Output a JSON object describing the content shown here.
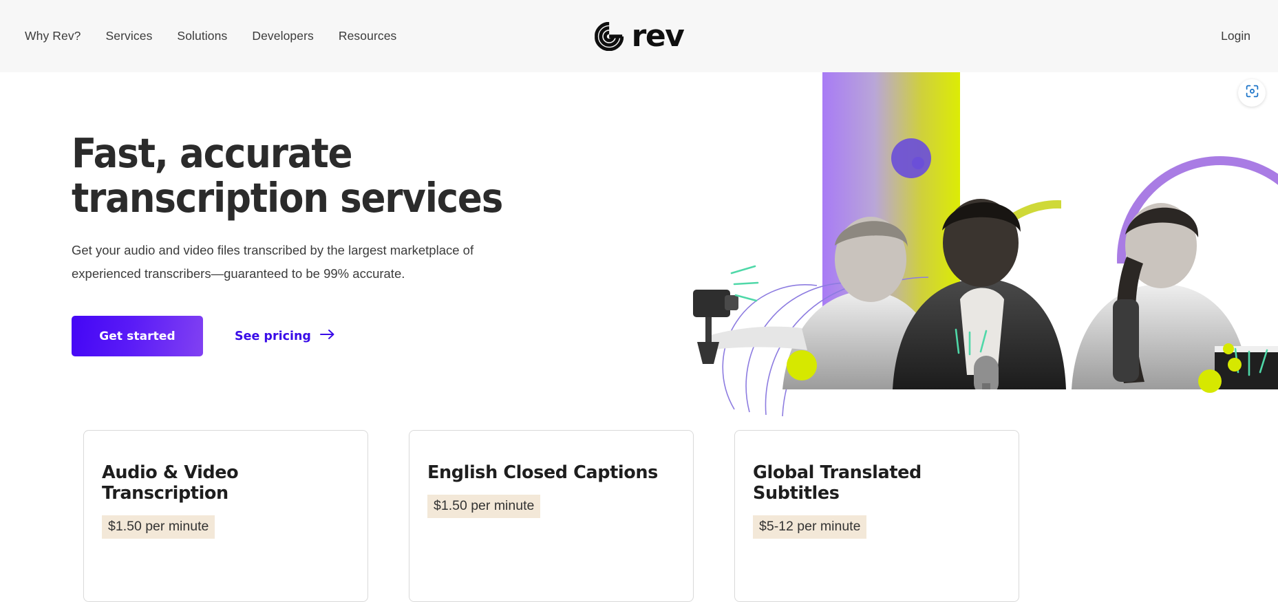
{
  "header": {
    "nav_items": [
      {
        "label": "Why Rev?"
      },
      {
        "label": "Services"
      },
      {
        "label": "Solutions"
      },
      {
        "label": "Developers"
      },
      {
        "label": "Resources"
      }
    ],
    "logo_word": "rev",
    "logo_mark_icon": "rev-spiral-icon",
    "login_label": "Login",
    "background_color": "#F7F7F7"
  },
  "hero": {
    "title": "Fast, accurate transcription services",
    "subtitle": "Get your audio and video files transcribed by the largest marketplace of experienced transcribers—guaranteed to be 99% accurate.",
    "primary_button": "Get started",
    "secondary_link": "See pricing",
    "secondary_link_icon": "arrow-right-icon",
    "primary_gradient_from": "#4406F5",
    "primary_gradient_to": "#8141F2",
    "link_color": "#3A0CE8",
    "art": {
      "gradient_from": "#A87BF5",
      "gradient_to": "#DCEC05",
      "accent_violet": "#6B4FD8",
      "accent_lime": "#D6E800",
      "arc_purple": "#A97CE4",
      "arc_lime": "#CFD938",
      "sound_arc_color": "#8C7BE0",
      "spark_color": "#4FD8A8"
    }
  },
  "scan_button": {
    "icon": "scan-lens-icon",
    "color": "#1A73C8"
  },
  "cards": [
    {
      "title": "Audio & Video Transcription",
      "price": "$1.50 per minute"
    },
    {
      "title": "English Closed Captions",
      "price": "$1.50 per minute"
    },
    {
      "title": "Global Translated Subtitles",
      "price": "$5-12 per minute"
    }
  ]
}
